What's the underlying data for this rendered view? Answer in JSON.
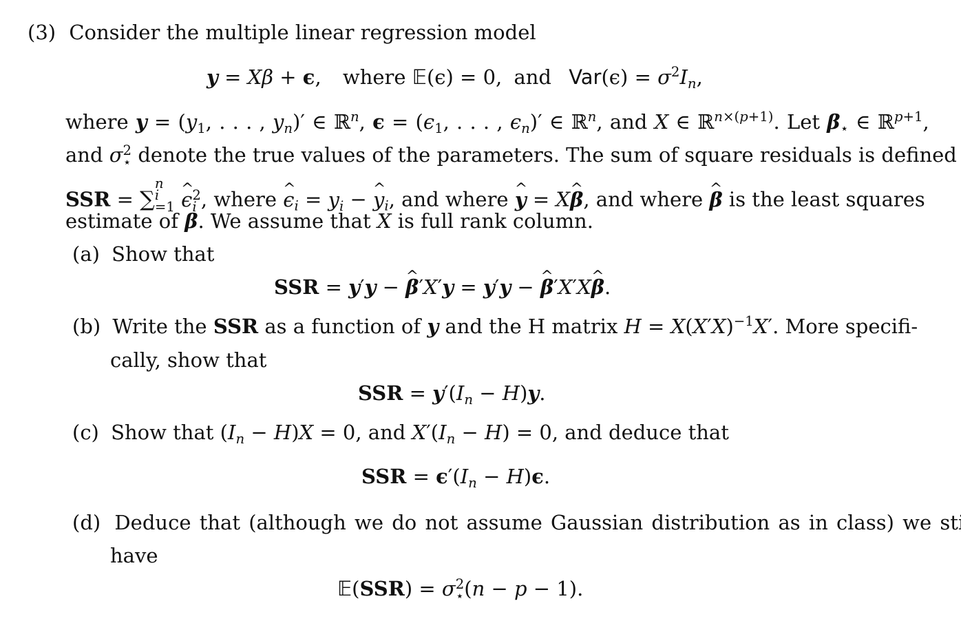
{
  "problem": {
    "number": "(3)",
    "intro": "Consider the multiple linear regression model",
    "model_eq": {
      "lhs": "y",
      "eq": "=",
      "rhs1": "Xβ",
      "plus": "+",
      "eps": "ϵ",
      "sep1": ",",
      "where": "where",
      "E": "𝔼",
      "mean_expr": "(ϵ)",
      "eq0": "= 0,",
      "and": "and",
      "var": "Var",
      "var_expr": "(ϵ)",
      "eq2": "=",
      "sigma": "σ",
      "sq": "2",
      "I": "I",
      "n": "n",
      "comma": ","
    },
    "definition_lines": [
      "where y = (y₁, . . . , yₙ)′ ∈ ℝⁿ, ϵ = (ϵ₁, . . . , ϵₙ)′ ∈ ℝⁿ, and X ∈ ℝ^{n×(p+1)}. Let β⋆ ∈ ℝ^{p+1},",
      "and σ⋆² denote the true values of the parameters. The sum of square residuals is defined as",
      "SSR = Σᵢ₌₁ⁿ ϵ̂ᵢ², where ϵ̂ᵢ = yᵢ − ŷᵢ, and where ŷ = Xβ̂, and where β̂ is the least squares",
      "estimate of β. We assume that X is full rank column."
    ],
    "text": {
      "where": "where",
      "and": "and",
      "let": "Let",
      "line2_rest": "denote the true values of the parameters. The sum of square residuals is defined as",
      "ssr": "SSR",
      "line3_where1": ", where",
      "line3_and_where": ", and where",
      "line3_and_where2": ", and where",
      "line3_tail": "is the least squares",
      "line4_a": "estimate of",
      "line4_b": ". We assume that",
      "line4_c": "is full rank column."
    },
    "parts": [
      {
        "label": "(a)",
        "text": "Show that",
        "equation": "SSR = y′y − β̂′X′y = y′y − β̂′X′Xβ̂."
      },
      {
        "label": "(b)",
        "text_a": "Write the",
        "text_bold": "SSR",
        "text_b": "as a function of",
        "text_c": "and the H matrix",
        "text_d": ". More specifi-",
        "text_cont": "cally, show that",
        "h_def": "H = X(X′X)⁻¹X′",
        "equation": "SSR = y′(Iₙ − H)y."
      },
      {
        "label": "(c)",
        "text_a": "Show that",
        "expr1": "(Iₙ − H)X = 0",
        "text_b": ", and",
        "expr2": "X′(Iₙ − H) = 0",
        "text_c": ", and deduce that",
        "equation": "SSR = ϵ′(Iₙ − H)ϵ."
      },
      {
        "label": "(d)",
        "text": "Deduce that (although we do not assume Gaussian distribution as in class) we still",
        "text_cont": "have",
        "equation": "𝔼(SSR) = σ⋆²(n − p − 1)."
      }
    ]
  }
}
